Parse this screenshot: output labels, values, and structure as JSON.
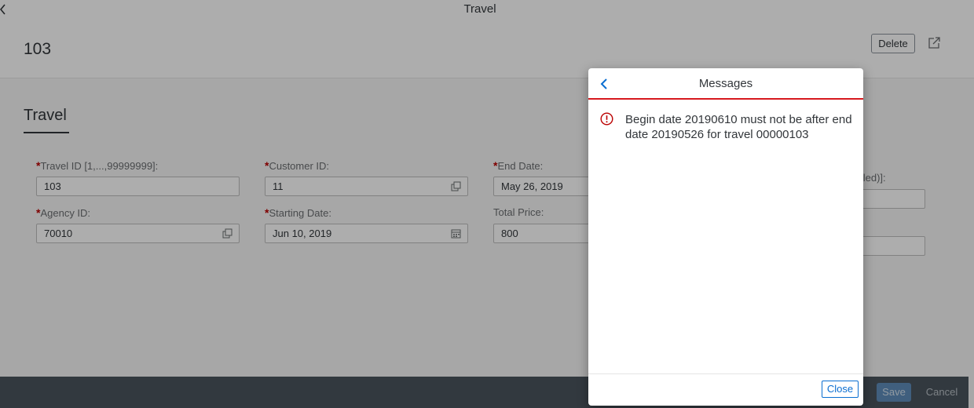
{
  "shell": {
    "title": "Travel"
  },
  "header": {
    "object_title": "103",
    "delete_label": "Delete"
  },
  "section": {
    "title": "Travel"
  },
  "form": {
    "travel_id": {
      "label": "Travel ID [1,...,99999999]:",
      "value": "103"
    },
    "customer_id": {
      "label": "Customer ID:",
      "value": "11"
    },
    "end_date": {
      "label": "End Date:",
      "value": "May 26, 2019"
    },
    "status": {
      "label_fragment": "celed)]:"
    },
    "agency_id": {
      "label": "Agency ID:",
      "value": "70010"
    },
    "starting_date": {
      "label": "Starting Date:",
      "value": "Jun 10, 2019"
    },
    "total_price": {
      "label": "Total Price:",
      "value": "800"
    },
    "required_mark": "*"
  },
  "footer": {
    "save_label": "Save",
    "cancel_label": "Cancel"
  },
  "dialog": {
    "title": "Messages",
    "messages": [
      {
        "type": "error",
        "text": "Begin date 20190610 must not be after end date 20190526 for travel 00000103"
      }
    ],
    "close_label": "Close"
  },
  "colors": {
    "accent": "#0a6ed1",
    "error": "#bb0000",
    "error_line": "#d7191e",
    "footer_bg": "#4a545d"
  }
}
